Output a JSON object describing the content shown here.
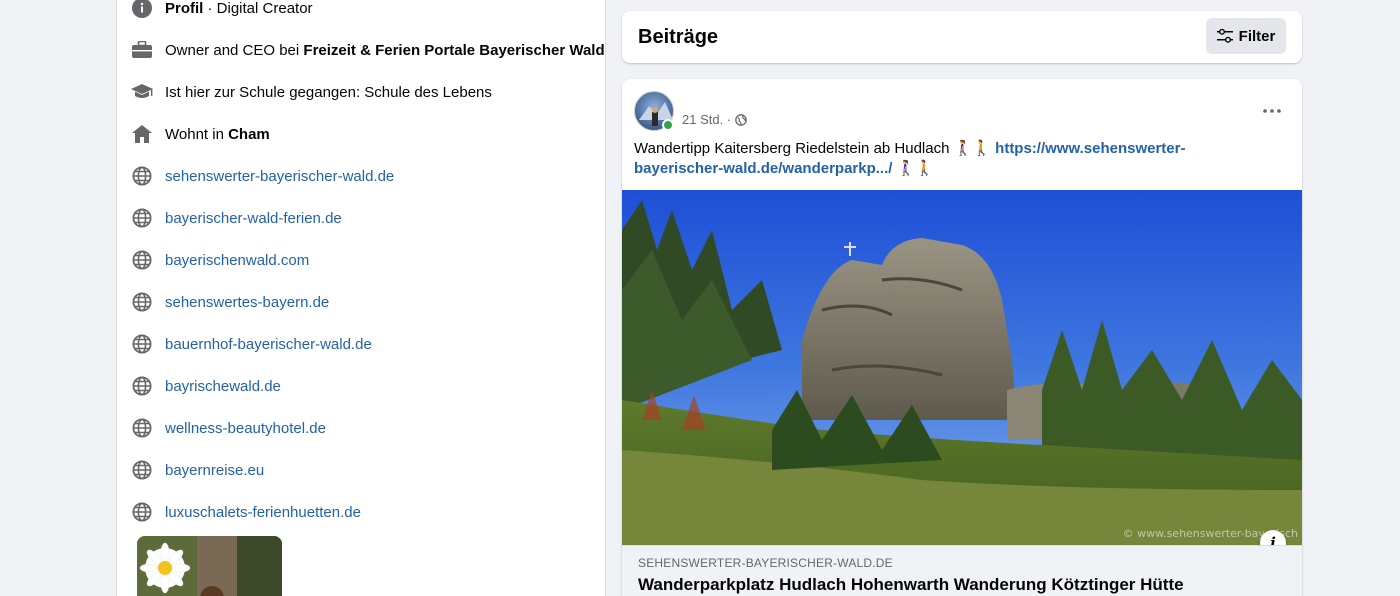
{
  "intro": {
    "profile_label": "Profil",
    "profile_suffix": " · Digital Creator",
    "work_prefix": "Owner and CEO bei ",
    "work_company": "Freizeit & Ferien Portale Bayerischer Wald",
    "school": "Ist hier zur Schule gegangen: Schule des Lebens",
    "home_prefix": "Wohnt in ",
    "home_city": "Cham",
    "websites": [
      "sehenswerter-bayerischer-wald.de",
      "bayerischer-wald-ferien.de",
      "bayerischenwald.com",
      "sehenswertes-bayern.de",
      "bauernhof-bayerischer-wald.de",
      "bayrischewald.de",
      "wellness-beautyhotel.de",
      "bayernreise.eu",
      "luxuschalets-ferienhuetten.de"
    ]
  },
  "posts_header": {
    "title": "Beiträge",
    "filter_label": "Filter"
  },
  "post": {
    "time": "21 Std. ·",
    "text_prefix": "Wandertipp Kaitersberg Riedelstein ab Hudlach 🚶‍♀️🚶 ",
    "link_text": "https://www.sehenswerter-bayerischer-wald.de/wanderparkp.../",
    "text_suffix": " 🚶‍♀️🚶",
    "watermark": "© www.sehenswerter-bayerisch",
    "preview_domain": "SEHENSWERTER-BAYERISCHER-WALD.DE",
    "preview_title": "Wanderparkplatz Hudlach Hohenwarth Wanderung Kötztinger Hütte"
  },
  "colors": {
    "link": "#2462a8",
    "background": "#f0f2f5",
    "online": "#31a24c"
  }
}
